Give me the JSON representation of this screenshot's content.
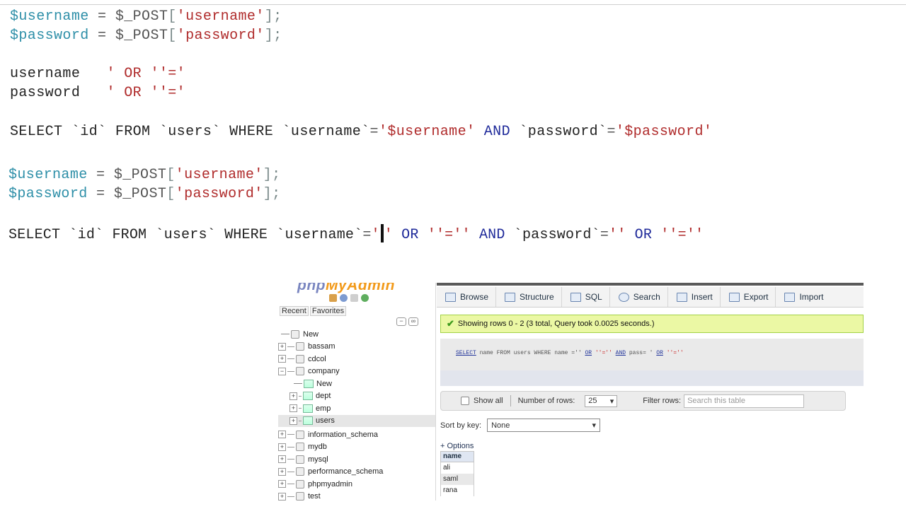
{
  "code": {
    "block1": {
      "line1": {
        "var": "$username",
        "eq": "=",
        "post": "$_POST",
        "lb": "[",
        "key": "'username'",
        "rb": "];"
      },
      "line2": {
        "var": "$password",
        "eq": "=",
        "post": "$_POST",
        "lb": "[",
        "key": "'password'",
        "rb": "];"
      }
    },
    "inputs": {
      "username": {
        "label": "username",
        "value": "' OR ''='"
      },
      "password": {
        "label": "password",
        "value": "' OR ''='"
      }
    },
    "query1": {
      "select": "SELECT",
      "col": "`id`",
      "from": "FROM",
      "table": "`users`",
      "where": "WHERE",
      "ucol": "`username`",
      "eq1": "=",
      "uval": "'$username'",
      "and": "AND",
      "pcol": "`password`",
      "eq2": "=",
      "pval": "'$password'"
    },
    "block2": {
      "line1": {
        "var": "$username",
        "eq": "=",
        "post": "$_POST",
        "lb": "[",
        "key": "'username'",
        "rb": "];"
      },
      "line2": {
        "var": "$password",
        "eq": "=",
        "post": "$_POST",
        "lb": "[",
        "key": "'password'",
        "rb": "];"
      }
    },
    "query2": {
      "select": "SELECT",
      "col": "`id`",
      "from": "FROM",
      "table": "`users`",
      "where": "WHERE",
      "ucol": "`username`",
      "eq1": "=",
      "q1": "'",
      "q1b": "'",
      "or1": "OR",
      "cmp1": "''=''",
      "and": "AND",
      "pcol": "`password`",
      "eq2": "=",
      "q2": "''",
      "or2": "OR",
      "cmp2": "''=''"
    }
  },
  "pma": {
    "logo": {
      "php": "php",
      "my": "MyAdmin"
    },
    "side_tabs": [
      "Recent",
      "Favorites"
    ],
    "tree": [
      {
        "label": "New"
      },
      {
        "label": "bassam"
      },
      {
        "label": "cdcol"
      },
      {
        "label": "company"
      },
      {
        "label": "New"
      },
      {
        "label": "dept"
      },
      {
        "label": "emp"
      },
      {
        "label": "users"
      },
      {
        "label": "information_schema"
      },
      {
        "label": "mydb"
      },
      {
        "label": "mysql"
      },
      {
        "label": "performance_schema"
      },
      {
        "label": "phpmyadmin"
      },
      {
        "label": "test"
      }
    ],
    "tabs": [
      "Browse",
      "Structure",
      "SQL",
      "Search",
      "Insert",
      "Export",
      "Import"
    ],
    "success_msg": "Showing rows 0 - 2 (3 total, Query took 0.0025 seconds.)",
    "sql": {
      "select": "SELECT",
      "rest1": " name FROM users WHERE name ='' ",
      "or1": "OR",
      "mid1": " ''='' ",
      "and": "AND",
      "mid2": " pass= ' ",
      "or2": "OR",
      "end": " ''=''"
    },
    "nav": {
      "show_all": "Show all",
      "num_rows_label": "Number of rows:",
      "num_rows_value": "25",
      "filter_label": "Filter rows:",
      "filter_placeholder": "Search this table"
    },
    "sort_label": "Sort by key:",
    "sort_value": "None",
    "options": "+ Options",
    "results": {
      "header": "name",
      "rows": [
        "ali",
        "saml",
        "rana"
      ]
    }
  }
}
